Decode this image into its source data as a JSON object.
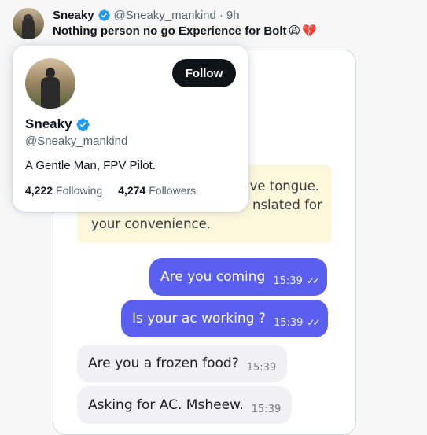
{
  "tweet": {
    "display_name": "Sneaky",
    "handle": "@Sneaky_mankind",
    "separator": "·",
    "time": "9h",
    "text": "Nothing person no go Experience for Bolt",
    "emoji_1": "😩",
    "emoji_2": "💔"
  },
  "hovercard": {
    "display_name": "Sneaky",
    "handle": "@Sneaky_mankind",
    "follow_label": "Follow",
    "bio": "A Gentle Man, FPV Pilot.",
    "following_count": "4,222",
    "following_label": "Following",
    "followers_count": "4,274",
    "followers_label": "Followers"
  },
  "chat": {
    "notice_lines": [
      "ive tongue.",
      "nslated for",
      "your convenience."
    ],
    "messages": [
      {
        "text": "Are you coming",
        "time": "15:39",
        "direction": "outgoing"
      },
      {
        "text": "Is your ac working ?",
        "time": "15:39",
        "direction": "outgoing"
      },
      {
        "text": "Are you a frozen food?",
        "time": "15:39",
        "direction": "incoming"
      },
      {
        "text": "Asking for AC. Msheew.",
        "time": "15:39",
        "direction": "incoming"
      }
    ]
  },
  "colors": {
    "verified": "#1d9bf0",
    "outgoing_bubble": "#5b5ff0",
    "incoming_bubble": "#f1f1f3",
    "notice_bg": "#fdf7dc",
    "follow_button": "#0f1419"
  },
  "icons": [
    "verified-badge-icon",
    "double-check-icon"
  ]
}
